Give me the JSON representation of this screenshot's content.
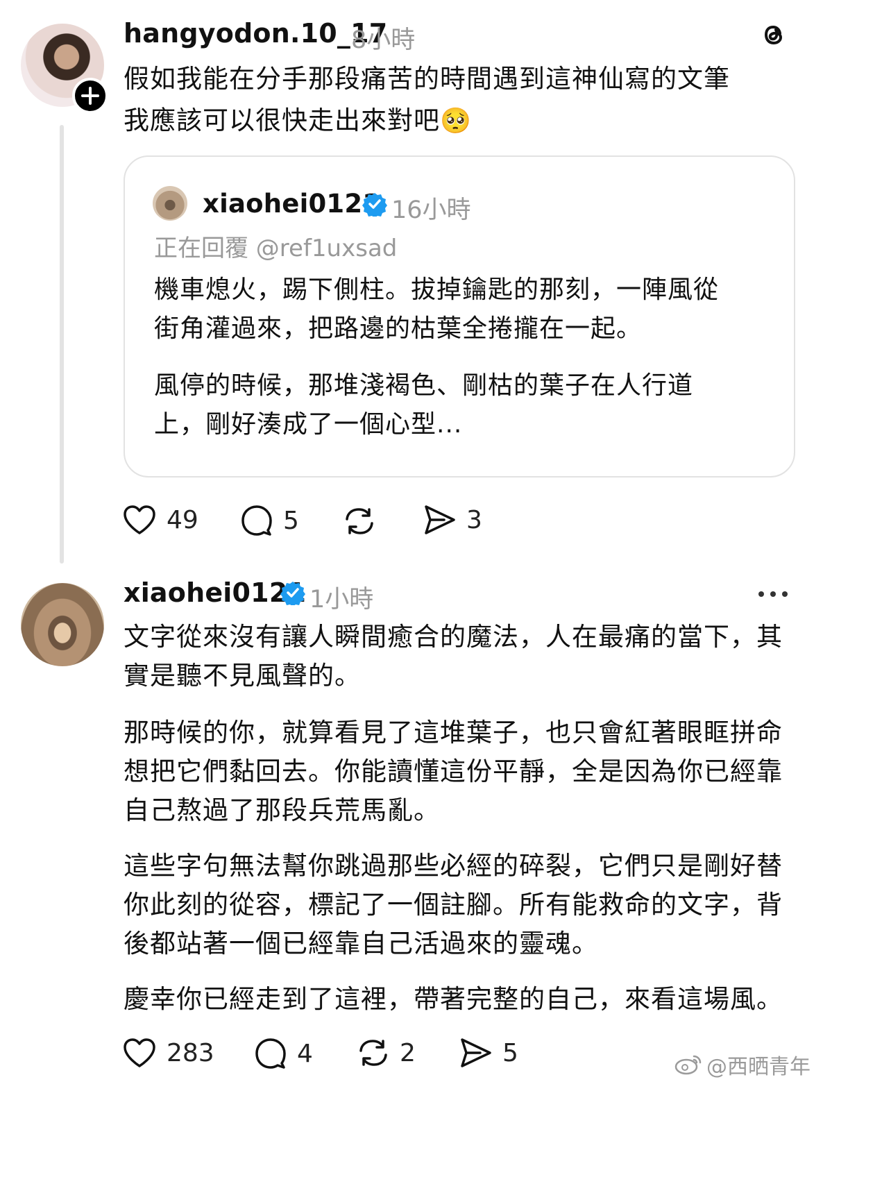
{
  "post1": {
    "username": "hangyodon.10_17",
    "time": "8小時",
    "lines": [
      "假如我能在分手那段痛苦的時間遇到這神仙寫的文筆",
      "我應該可以很快走出來對吧"
    ],
    "emoji": "🥺",
    "likes": "49",
    "comments": "5",
    "shares": "3"
  },
  "quote": {
    "username": "xiaohei0121",
    "time": "16小時",
    "replying_to": "正在回覆 @ref1uxsad",
    "paragraph1": [
      "機車熄火，踢下側柱。拔掉鑰匙的那刻，一陣風從",
      "街角灌過來，把路邊的枯葉全捲攏在一起。"
    ],
    "paragraph2": [
      "風停的時候，那堆淺褐色、剛枯的葉子在人行道",
      "上，剛好湊成了一個心型..."
    ]
  },
  "post2": {
    "username": "xiaohei0121",
    "time": "1小時",
    "paragraph1": [
      "文字從來沒有讓人瞬間癒合的魔法，人在最痛的當下，其",
      "實是聽不見風聲的。"
    ],
    "paragraph2": [
      "那時候的你，就算看見了這堆葉子，也只會紅著眼眶拼命",
      "想把它們黏回去。你能讀懂這份平靜，全是因為你已經靠",
      "自己熬過了那段兵荒馬亂。"
    ],
    "paragraph3": [
      "這些字句無法幫你跳過那些必經的碎裂，它們只是剛好替",
      "你此刻的從容，標記了一個註腳。所有能救命的文字，背",
      "後都站著一個已經靠自己活過來的靈魂。"
    ],
    "paragraph4": [
      "慶幸你已經走到了這裡，帶著完整的自己，來看這場風。"
    ],
    "likes": "283",
    "comments": "4",
    "reposts": "2",
    "shares": "5"
  },
  "watermark": "@西晒青年",
  "colors": {
    "verified": "#1d9bf0",
    "muted": "#999999",
    "line": "#e3e3e3"
  },
  "icons": [
    "threads-logo-icon",
    "follow-plus-icon",
    "verified-icon",
    "heart-icon",
    "comment-icon",
    "repost-icon",
    "share-icon",
    "more-icon",
    "weibo-icon"
  ]
}
